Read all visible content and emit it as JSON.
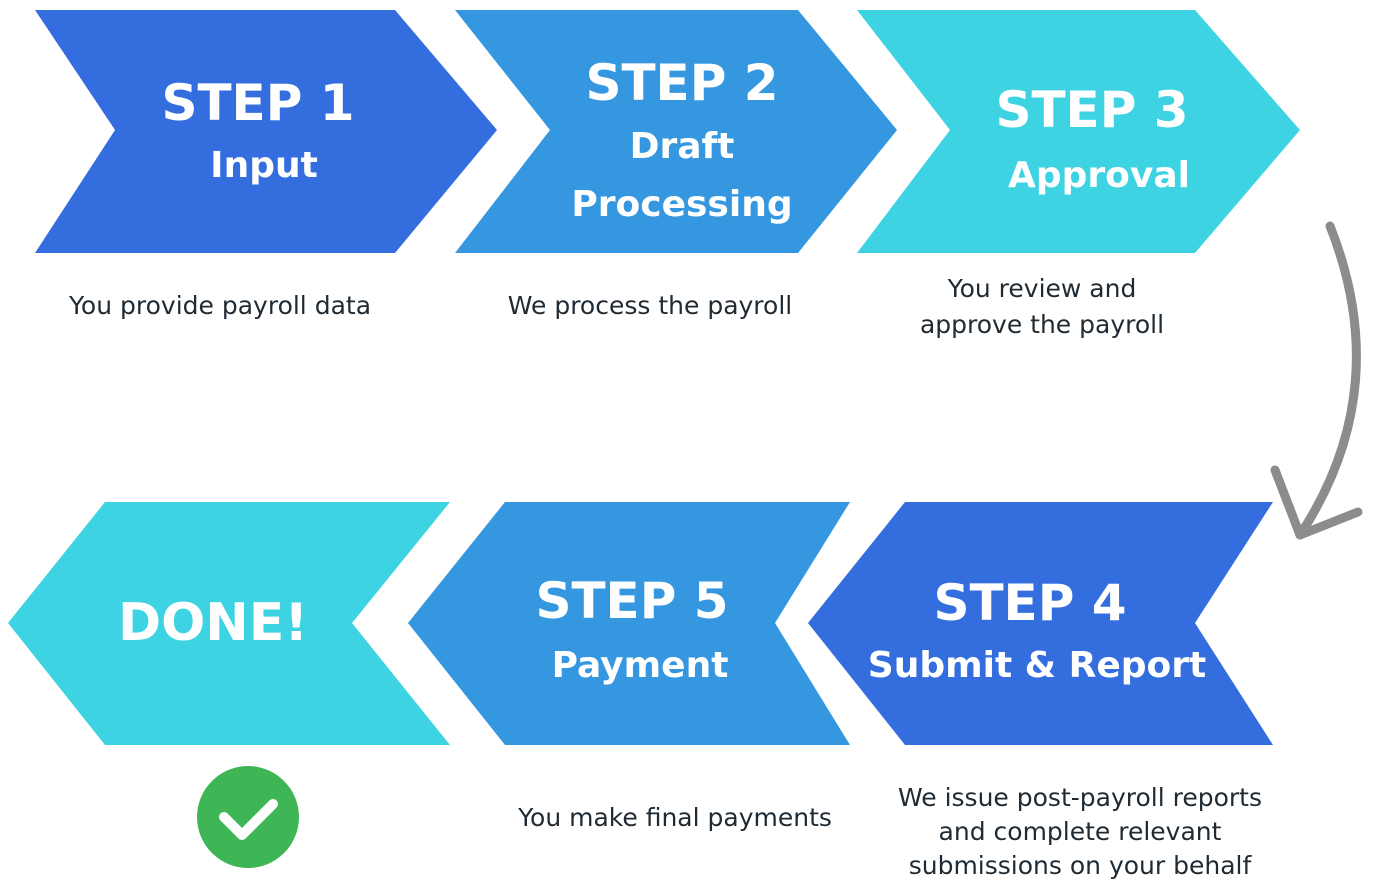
{
  "colors": {
    "royal_blue": "#346ede",
    "mid_blue": "#3597e0",
    "cyan": "#3ed3e2",
    "arrow_gray": "#8c8c8c",
    "check_green": "#3fb655",
    "caption_text": "#1f2a33"
  },
  "steps": [
    {
      "id": "step-1",
      "label": "STEP 1",
      "subtitle_lines": [
        "Input"
      ],
      "caption": "You provide payroll data"
    },
    {
      "id": "step-2",
      "label": "STEP 2",
      "subtitle_lines": [
        "Draft",
        "Processing"
      ],
      "caption": "We process the payroll"
    },
    {
      "id": "step-3",
      "label": "STEP 3",
      "subtitle_lines": [
        "Approval"
      ],
      "caption": "You review and\napprove the payroll"
    },
    {
      "id": "step-4",
      "label": "STEP 4",
      "subtitle_lines": [
        "Submit & Report"
      ],
      "caption": "We issue post-payroll reports\nand complete relevant\nsubmissions on your behalf"
    },
    {
      "id": "step-5",
      "label": "STEP 5",
      "subtitle_lines": [
        "Payment"
      ],
      "caption": "You make final payments"
    }
  ],
  "done": {
    "label": "DONE!",
    "icon": "check-circle-icon"
  },
  "connector": {
    "icon": "curved-arrow-icon"
  }
}
